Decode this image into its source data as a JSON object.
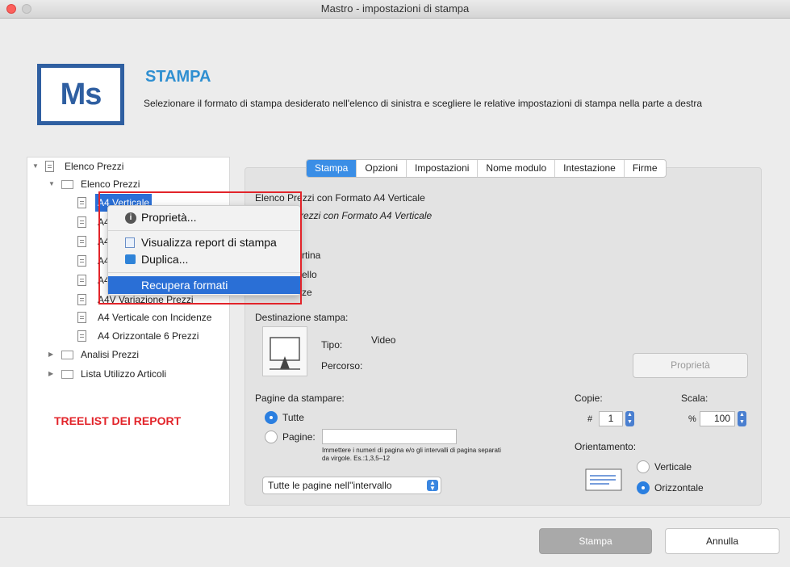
{
  "window": {
    "title": "Mastro - impostazioni di stampa"
  },
  "header": {
    "logo_text": "Ms",
    "title": "STAMPA",
    "description": "Selezionare il formato di stampa desiderato nell'elenco di sinistra e scegliere le relative impostazioni di stampa nella parte a destra"
  },
  "tree": {
    "root": "Elenco Prezzi",
    "folder_elenco": "Elenco Prezzi",
    "items": [
      "A4 Verticale",
      "A4",
      "A4",
      "A4",
      "A4",
      "A4V Variazione Prezzi",
      "A4 Verticale con Incidenze",
      "A4 Orizzontale 6 Prezzi"
    ],
    "folder_analisi": "Analisi Prezzi",
    "folder_lista": "Lista Utilizzo Articoli",
    "annotation": "TREELIST DEI REPORT"
  },
  "tabs": [
    "Stampa",
    "Opzioni",
    "Impostazioni",
    "Nome modulo",
    "Intestazione",
    "Firme"
  ],
  "details": {
    "line1": "Elenco Prezzi con Formato  A4 Verticale",
    "line2": "rezzi con Formato  A4 Verticale",
    "partial1": "rtina",
    "partial2": "ello",
    "partial3": "ze"
  },
  "destination": {
    "label": "Destinazione stampa:",
    "type_label": "Tipo:",
    "type_value": "Video",
    "path_label": "Percorso:",
    "properties_button": "Proprietà"
  },
  "pages": {
    "label": "Pagine da stampare:",
    "option_all": "Tutte",
    "option_pages": "Pagine:",
    "pages_value": "",
    "hint": "Immettere i numeri di pagina e/o gli intervalli di pagina separati da virgole. Es.:1,3,5–12",
    "range_select": "Tutte le pagine nell''intervallo"
  },
  "copies": {
    "label": "Copie:",
    "prefix": "#",
    "value": "1"
  },
  "scale": {
    "label": "Scala:",
    "prefix": "%",
    "value": "100"
  },
  "orientation": {
    "label": "Orientamento:",
    "vertical": "Verticale",
    "horizontal": "Orizzontale"
  },
  "context_menu": {
    "properties": "Proprietà...",
    "view_report": "Visualizza report di stampa",
    "duplicate": "Duplica...",
    "recover": "Recupera formati"
  },
  "footer": {
    "print_button": "Stampa",
    "cancel_button": "Annulla"
  }
}
